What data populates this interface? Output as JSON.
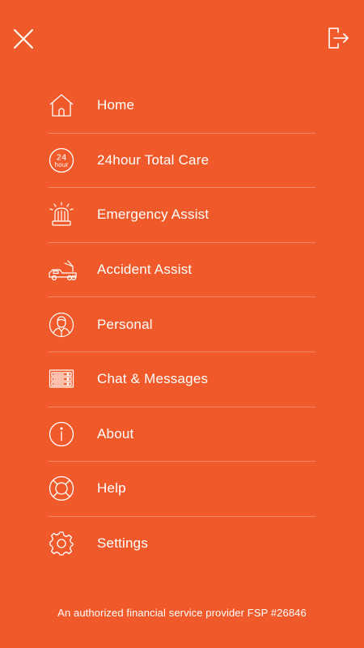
{
  "header": {
    "close_icon": "close-icon",
    "logout_icon": "logout-icon"
  },
  "menu": {
    "items": [
      {
        "label": "Home",
        "icon": "home-icon"
      },
      {
        "label": "24hour Total Care",
        "icon": "24hour-icon"
      },
      {
        "label": "Emergency Assist",
        "icon": "emergency-siren-icon"
      },
      {
        "label": "Accident Assist",
        "icon": "tow-truck-icon"
      },
      {
        "label": "Personal",
        "icon": "person-icon"
      },
      {
        "label": "Chat & Messages",
        "icon": "chat-messages-icon"
      },
      {
        "label": "About",
        "icon": "info-icon"
      },
      {
        "label": "Help",
        "icon": "lifebuoy-icon"
      },
      {
        "label": "Settings",
        "icon": "gear-icon"
      }
    ],
    "icon_24_text_top": "24",
    "icon_24_text_bottom": "hour"
  },
  "footer": {
    "text": "An authorized financial service provider FSP #26846"
  },
  "colors": {
    "background": "#F05A2A",
    "foreground": "#FFFFFF"
  }
}
